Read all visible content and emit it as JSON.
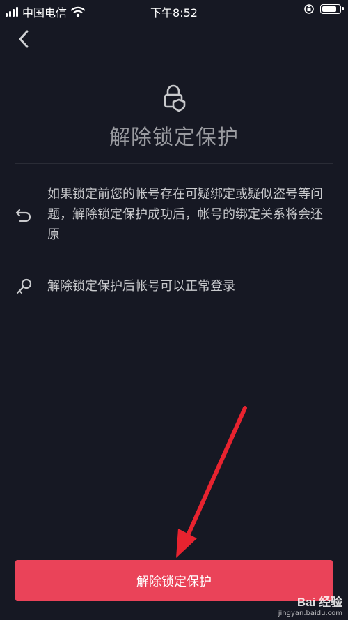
{
  "status_bar": {
    "carrier": "中国电信",
    "time": "下午8:52",
    "battery_level": 0.85
  },
  "header": {
    "back_icon": "chevron-left-icon",
    "title": "解除锁定保护"
  },
  "info_items": [
    {
      "icon": "undo-icon",
      "text": "如果锁定前您的帐号存在可疑绑定或疑似盗号等问题，解除锁定保护成功后，帐号的绑定关系将会还原"
    },
    {
      "icon": "key-icon",
      "text": "解除锁定保护后帐号可以正常登录"
    }
  ],
  "primary_button": {
    "label": "解除锁定保护",
    "color": "#ea4359"
  },
  "watermark": {
    "logo": "Bai 经验",
    "url": "jingyan.baidu.com"
  },
  "colors": {
    "background": "#161823",
    "title": "#9a9ba0",
    "body_text": "#c8c9cc",
    "annotation_arrow": "#e8232f"
  }
}
